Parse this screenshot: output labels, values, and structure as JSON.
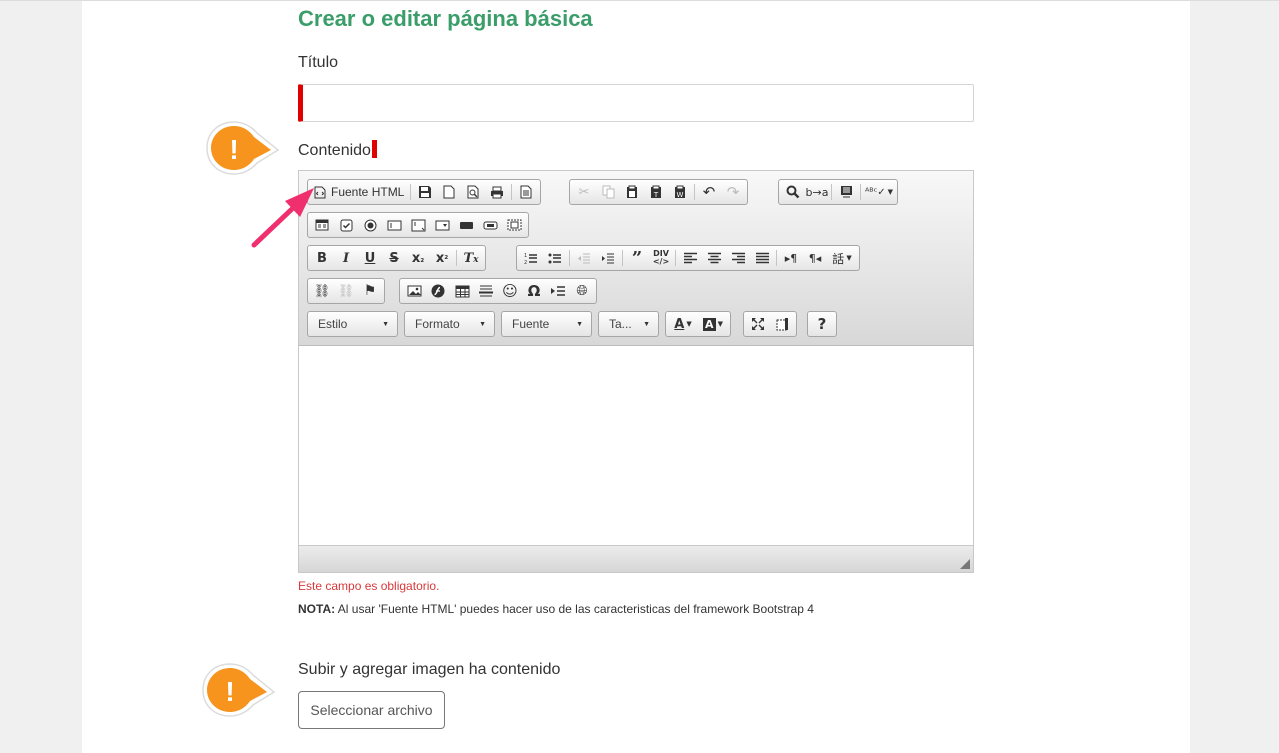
{
  "page": {
    "title": "Crear o editar página básica",
    "titulo_label": "Título",
    "contenido_label": "Contenido",
    "error_text": "Este campo es obligatorio.",
    "note_bold": "NOTA:",
    "note_text": " Al usar 'Fuente HTML' puedes hacer uso de las caracteristicas del framework Bootstrap 4",
    "upload_label": "Subir y agregar imagen ha contenido",
    "upload_button": "Seleccionar archivo",
    "titulo_value": ""
  },
  "editor": {
    "source_button": "Fuente HTML",
    "combos": {
      "style": "Estilo",
      "format": "Formato",
      "font": "Fuente",
      "size": "Ta..."
    }
  },
  "annotations": {
    "warning_symbol": "!",
    "warning_color": "#f7941d",
    "arrow_color": "#f0306e"
  },
  "colors": {
    "title_green": "#3a9d6a",
    "required_red": "#e00000",
    "error_red": "#d9383a"
  }
}
